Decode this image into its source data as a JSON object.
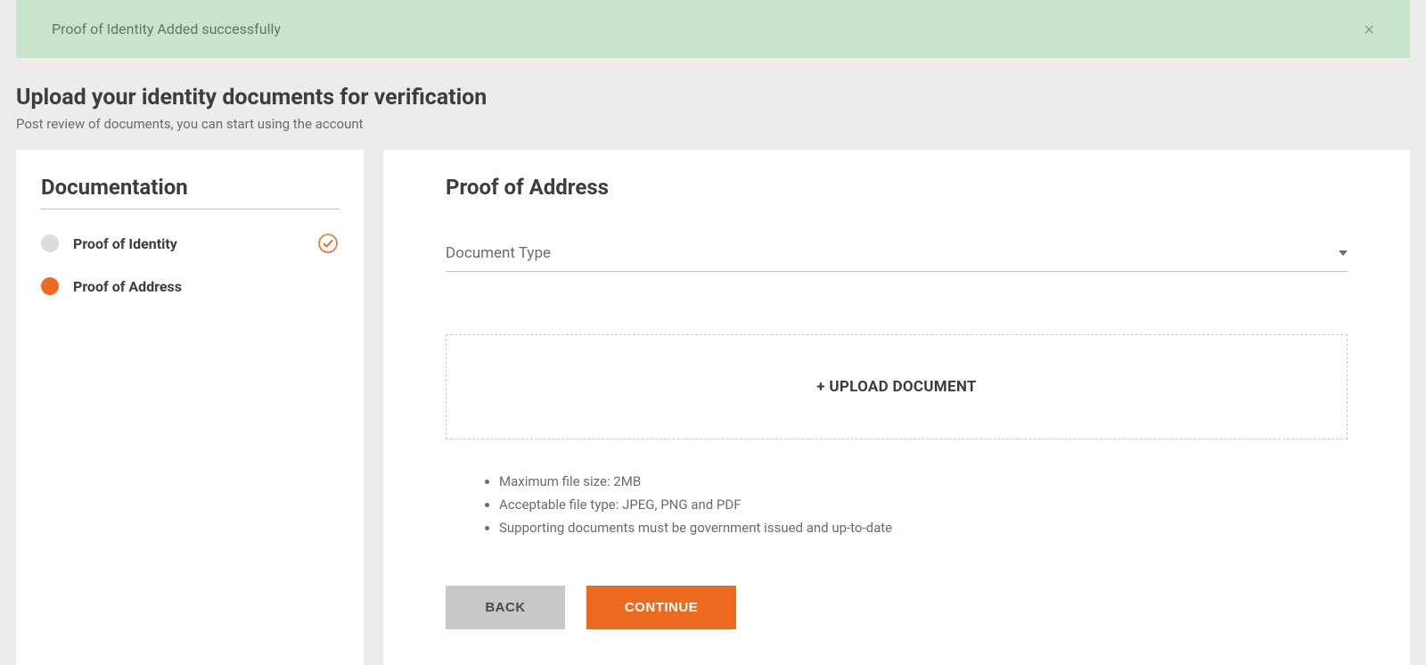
{
  "alert": {
    "message": "Proof of Identity Added successfully",
    "close_symbol": "×"
  },
  "header": {
    "title": "Upload your identity documents for verification",
    "subtitle": "Post review of documents, you can start using the account"
  },
  "sidebar": {
    "title": "Documentation",
    "steps": [
      {
        "label": "Proof of Identity",
        "done": true,
        "active": false
      },
      {
        "label": "Proof of Address",
        "done": false,
        "active": true
      }
    ]
  },
  "main": {
    "title": "Proof of Address",
    "select_label": "Document Type",
    "upload_label": "+ UPLOAD DOCUMENT",
    "hints": [
      "Maximum file size: 2MB",
      "Acceptable file type: JPEG, PNG and PDF",
      "Supporting documents must be government issued and up-to-date"
    ],
    "back_label": "BACK",
    "continue_label": "CONTINUE"
  },
  "colors": {
    "accent": "#ec6b1e",
    "success_bg": "#c6e5ca"
  }
}
